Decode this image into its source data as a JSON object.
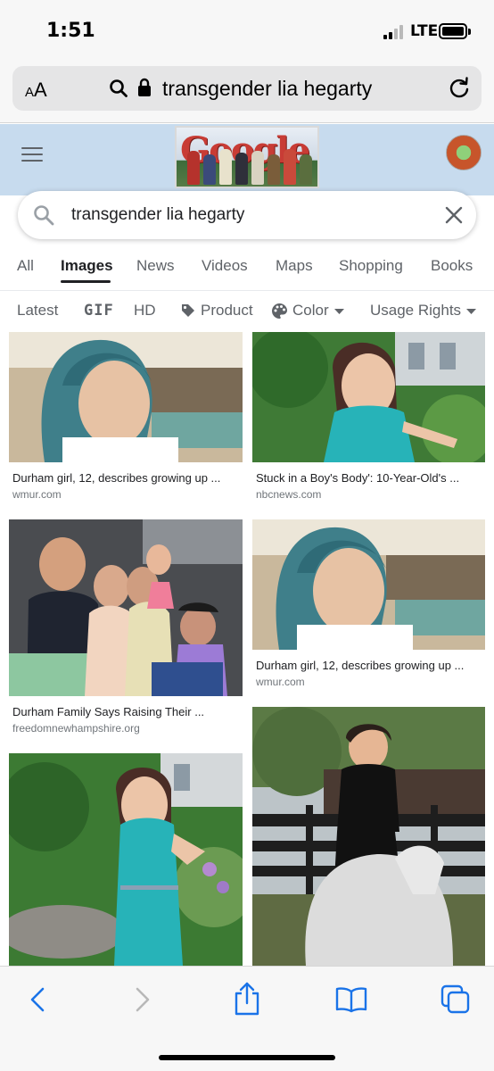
{
  "status": {
    "time": "1:51",
    "network": "LTE"
  },
  "browser": {
    "text_size_label_small": "A",
    "text_size_label_large": "A",
    "url": "transgender lia hegarty",
    "icons": [
      "search-icon",
      "lock-icon",
      "reload-icon"
    ]
  },
  "google": {
    "doodle_text": "Google",
    "search_query": "transgender lia hegarty"
  },
  "tabs": [
    {
      "label": "All",
      "active": false
    },
    {
      "label": "Images",
      "active": true
    },
    {
      "label": "News",
      "active": false
    },
    {
      "label": "Videos",
      "active": false
    },
    {
      "label": "Maps",
      "active": false
    },
    {
      "label": "Shopping",
      "active": false
    },
    {
      "label": "Books",
      "active": false
    }
  ],
  "filters": {
    "latest": "Latest",
    "gif": "GIF",
    "hd": "HD",
    "product": "Product",
    "color": "Color",
    "usage_rights": "Usage Rights"
  },
  "results": [
    {
      "title": "Durham girl, 12, describes growing up ...",
      "source": "wmur.com"
    },
    {
      "title": "Stuck in a Boy's Body': 10-Year-Old's ...",
      "source": "nbcnews.com"
    },
    {
      "title": "Durham Family Says Raising Their ...",
      "source": "freedomnewhampshire.org"
    },
    {
      "title": "Durham girl, 12, describes growing up ...",
      "source": "wmur.com"
    }
  ],
  "colors": {
    "header_bg": "#c7dbee",
    "active_tab": "#202124",
    "safari_blue": "#1a73e8"
  },
  "bottom_bar_icons": [
    "back-icon",
    "forward-icon",
    "share-icon",
    "bookmarks-icon",
    "tabs-icon"
  ]
}
